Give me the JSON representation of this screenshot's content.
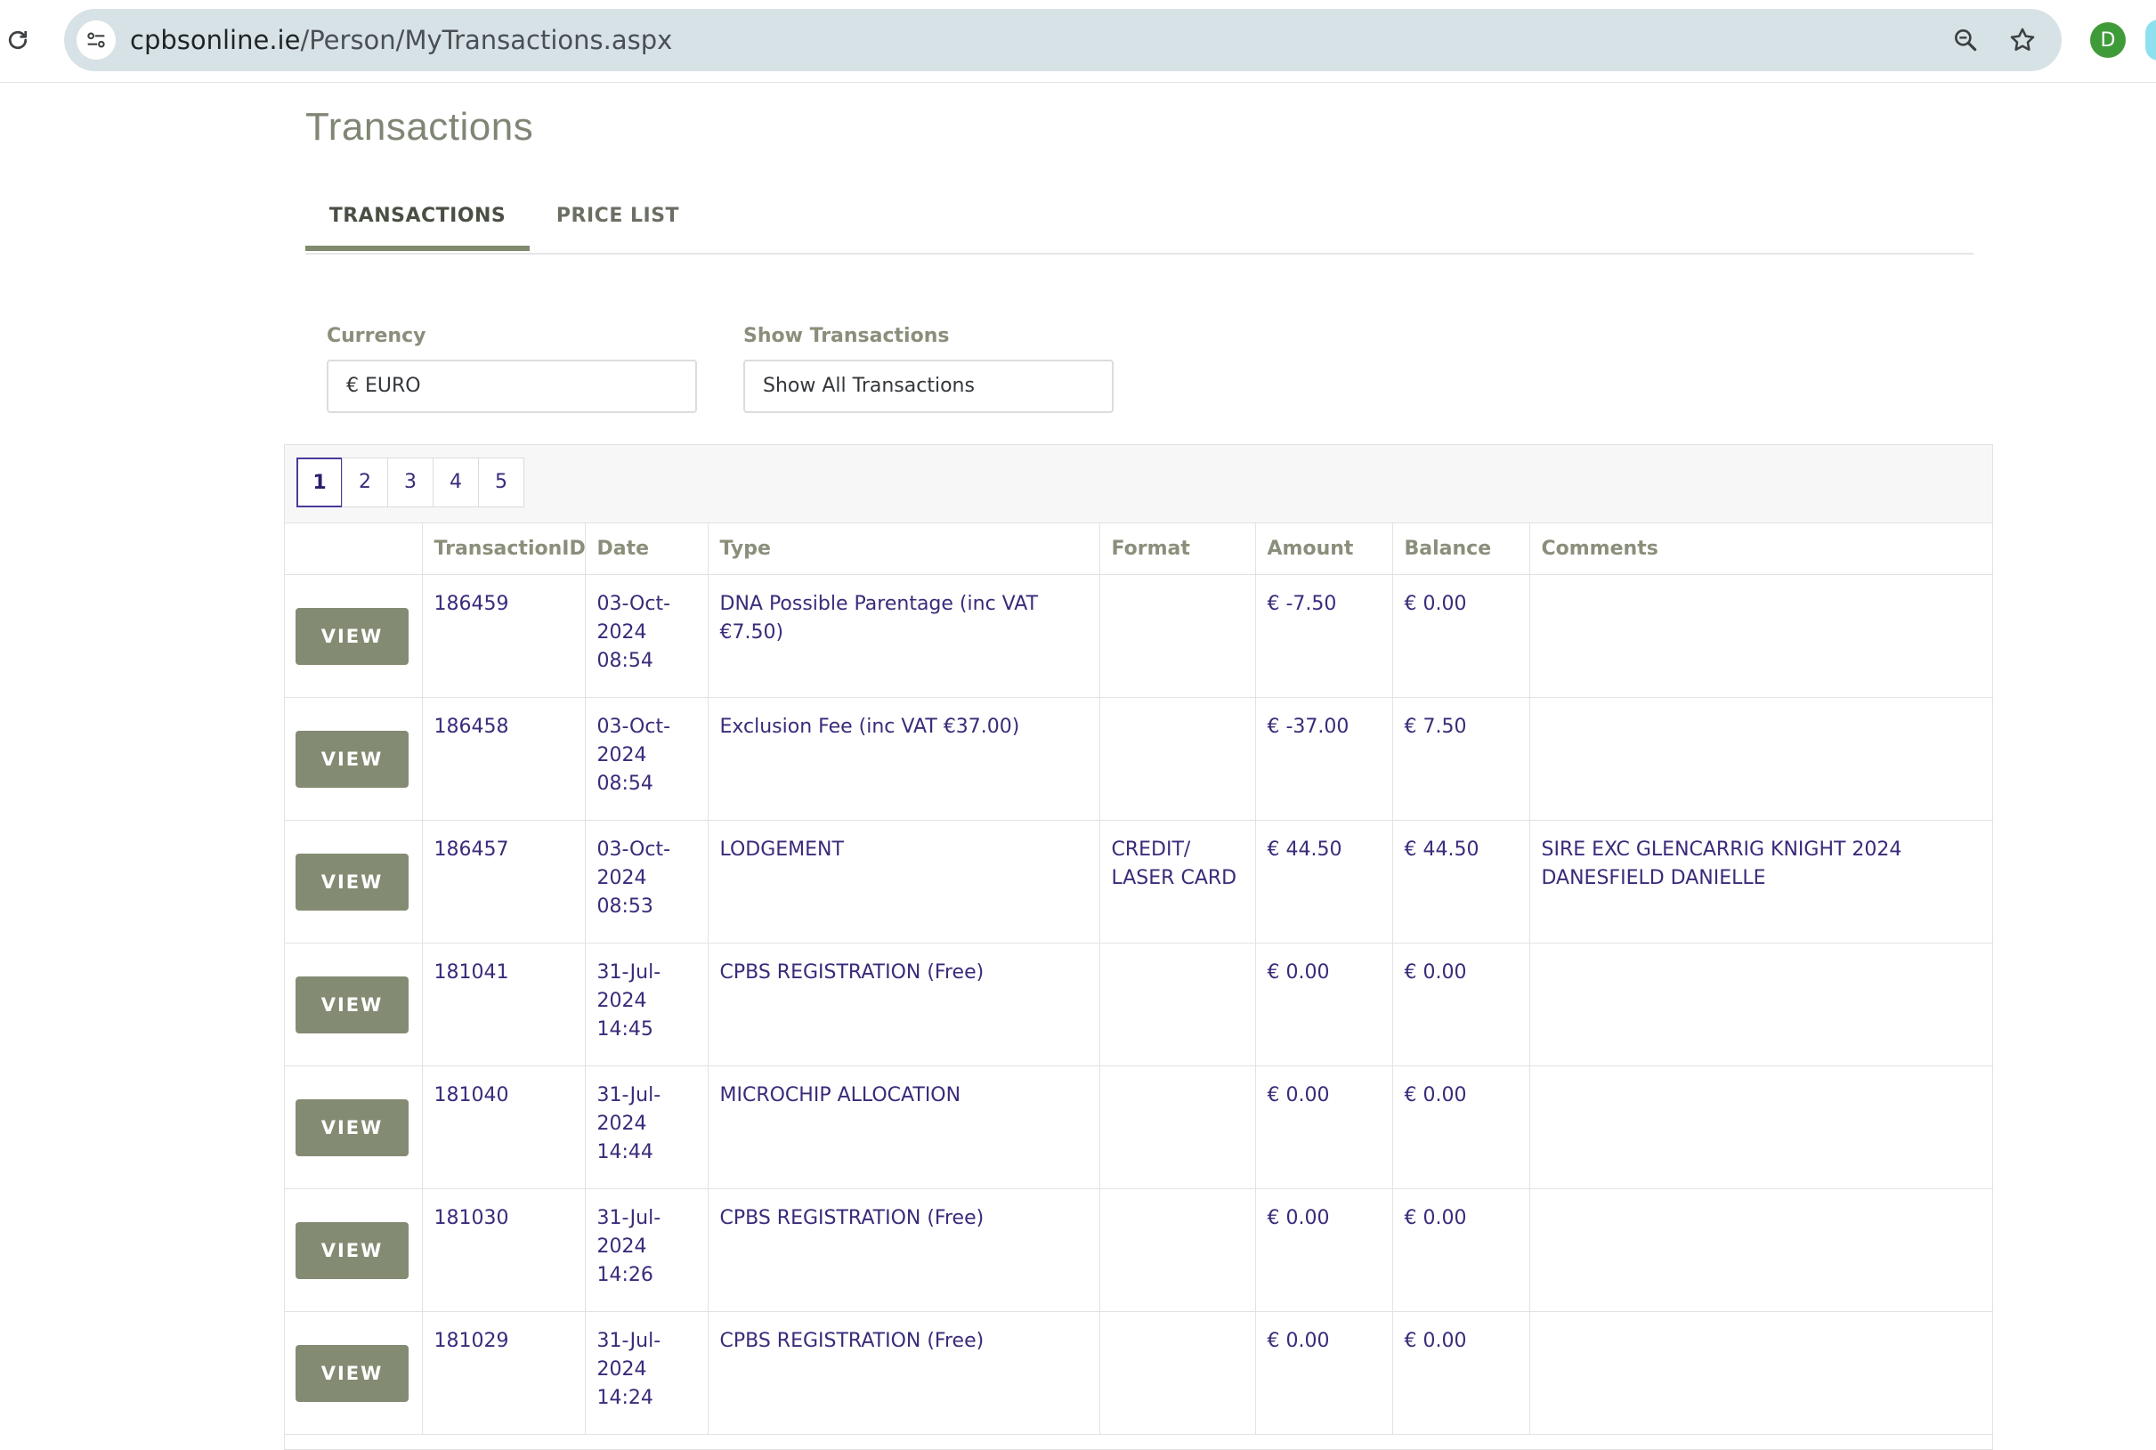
{
  "browser": {
    "url_host": "cpbsonline.ie",
    "url_path": "/Person/MyTransactions.aspx",
    "profile_initial": "D",
    "icons": [
      "reload-icon",
      "site-info-icon",
      "zoom-icon",
      "bookmark-star-icon"
    ]
  },
  "page": {
    "title": "Transactions",
    "tabs": [
      {
        "label": "TRANSACTIONS",
        "active": true
      },
      {
        "label": "PRICE LIST",
        "active": false
      }
    ]
  },
  "filters": {
    "currency": {
      "label": "Currency",
      "value": "€ EURO"
    },
    "show_transactions": {
      "label": "Show Transactions",
      "value": "Show All Transactions"
    }
  },
  "pager": {
    "pages": [
      "1",
      "2",
      "3",
      "4",
      "5"
    ],
    "current": "1"
  },
  "table": {
    "columns": [
      "",
      "TransactionID",
      "Date",
      "Type",
      "Format",
      "Amount",
      "Balance",
      "Comments"
    ],
    "view_label": "VIEW",
    "rows": [
      {
        "id": "186459",
        "date": "03-Oct-\n2024\n08:54",
        "type": "DNA Possible Parentage (inc VAT €7.50)",
        "format": "",
        "amount": "€ -7.50",
        "balance": "€ 0.00",
        "comments": ""
      },
      {
        "id": "186458",
        "date": "03-Oct-\n2024\n08:54",
        "type": "Exclusion Fee (inc VAT €37.00)",
        "format": "",
        "amount": "€ -37.00",
        "balance": "€ 7.50",
        "comments": ""
      },
      {
        "id": "186457",
        "date": "03-Oct-\n2024\n08:53",
        "type": "LODGEMENT",
        "format": "CREDIT/\nLASER CARD",
        "amount": "€ 44.50",
        "balance": "€ 44.50",
        "comments": "SIRE EXC GLENCARRIG KNIGHT 2024\nDANESFIELD DANIELLE"
      },
      {
        "id": "181041",
        "date": "31-Jul-\n2024\n14:45",
        "type": "CPBS REGISTRATION (Free)",
        "format": "",
        "amount": "€ 0.00",
        "balance": "€ 0.00",
        "comments": ""
      },
      {
        "id": "181040",
        "date": "31-Jul-\n2024\n14:44",
        "type": "MICROCHIP ALLOCATION",
        "format": "",
        "amount": "€ 0.00",
        "balance": "€ 0.00",
        "comments": ""
      },
      {
        "id": "181030",
        "date": "31-Jul-\n2024\n14:26",
        "type": "CPBS REGISTRATION (Free)",
        "format": "",
        "amount": "€ 0.00",
        "balance": "€ 0.00",
        "comments": ""
      },
      {
        "id": "181029",
        "date": "31-Jul-\n2024\n14:24",
        "type": "CPBS REGISTRATION (Free)",
        "format": "",
        "amount": "€ 0.00",
        "balance": "€ 0.00",
        "comments": ""
      }
    ]
  }
}
